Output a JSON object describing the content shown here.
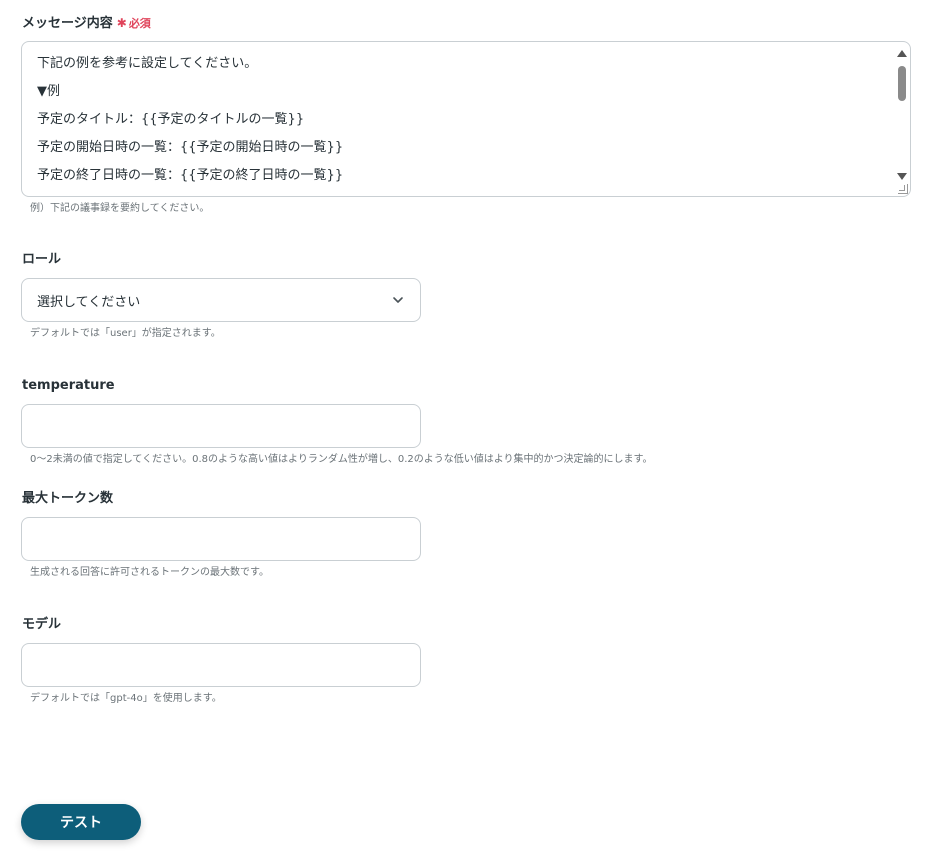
{
  "message": {
    "label": "メッセージ内容",
    "required_mark": "✱",
    "required_text": "必須",
    "lines": [
      "下記の例を参考に設定してください。",
      "▼例",
      "予定のタイトル：{{予定のタイトルの一覧}}",
      "予定の開始日時の一覧：{{予定の開始日時の一覧}}",
      "予定の終了日時の一覧：{{予定の終了日時の一覧}}"
    ],
    "help": "例）下記の議事録を要約してください。"
  },
  "role": {
    "label": "ロール",
    "placeholder": "選択してください",
    "help": "デフォルトでは「user」が指定されます。"
  },
  "temperature": {
    "label": "temperature",
    "value": "",
    "help": "0〜2未満の値で指定してください。0.8のような高い値はよりランダム性が増し、0.2のような低い値はより集中的かつ決定論的にします。"
  },
  "max_tokens": {
    "label": "最大トークン数",
    "value": "",
    "help": "生成される回答に許可されるトークンの最大数です。"
  },
  "model": {
    "label": "モデル",
    "value": "",
    "help": "デフォルトでは「gpt-4o」を使用します。"
  },
  "test_button": {
    "label": "テスト"
  },
  "colors": {
    "primary": "#0d5e7a",
    "required": "#e0445b",
    "border": "#c9cfd3",
    "text": "#283238",
    "help_text": "#6b7378"
  },
  "icons": {
    "select": "chevron-down-icon",
    "scroll_up": "triangle-up-icon",
    "scroll_down": "triangle-down-icon"
  }
}
